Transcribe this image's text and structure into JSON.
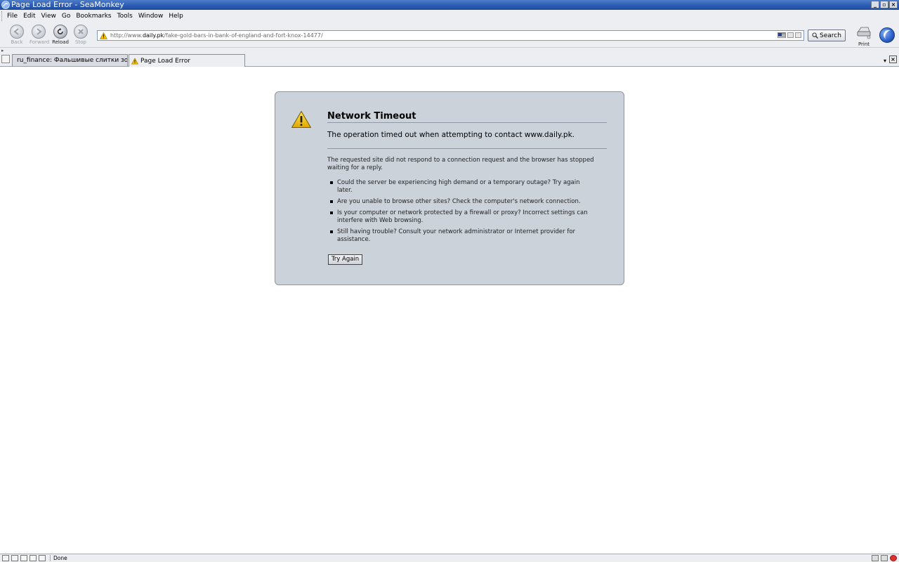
{
  "window": {
    "title": "Page Load Error - SeaMonkey",
    "controls": [
      "_",
      "▫",
      "×"
    ]
  },
  "menubar": {
    "items": [
      "File",
      "Edit",
      "View",
      "Go",
      "Bookmarks",
      "Tools",
      "Window",
      "Help"
    ]
  },
  "navbar": {
    "back_label": "Back",
    "forward_label": "Forward",
    "reload_label": "Reload",
    "stop_label": "Stop",
    "url_prefix": "http://www.",
    "url_host": "daily.pk",
    "url_path": "/fake-gold-bars-in-bank-of-england-and-fort-knox-14477/",
    "search_label": "Search",
    "print_label": "Print"
  },
  "tabs": [
    {
      "label": "ru_finance: Фальшивые слитки зол...",
      "active": false
    },
    {
      "label": "Page Load Error",
      "active": true
    }
  ],
  "error": {
    "title": "Network Timeout",
    "short_desc": "The operation timed out when attempting to contact www.daily.pk.",
    "long_desc": "The requested site did not respond to a connection request and the browser has stopped waiting for a reply.",
    "bullets": [
      "Could the server be experiencing high demand or a temporary outage? Try again later.",
      "Are you unable to browse other sites? Check the computer's network connection.",
      "Is your computer or network protected by a firewall or proxy? Incorrect settings can interfere with Web browsing.",
      "Still having trouble? Consult your network administrator or Internet provider for assistance."
    ],
    "try_again_label": "Try Again"
  },
  "statusbar": {
    "text": "Done"
  },
  "colors": {
    "titlebar": "#2f5fb6",
    "error_box_bg": "#cbd2da",
    "warning_yellow": "#f2c200"
  }
}
